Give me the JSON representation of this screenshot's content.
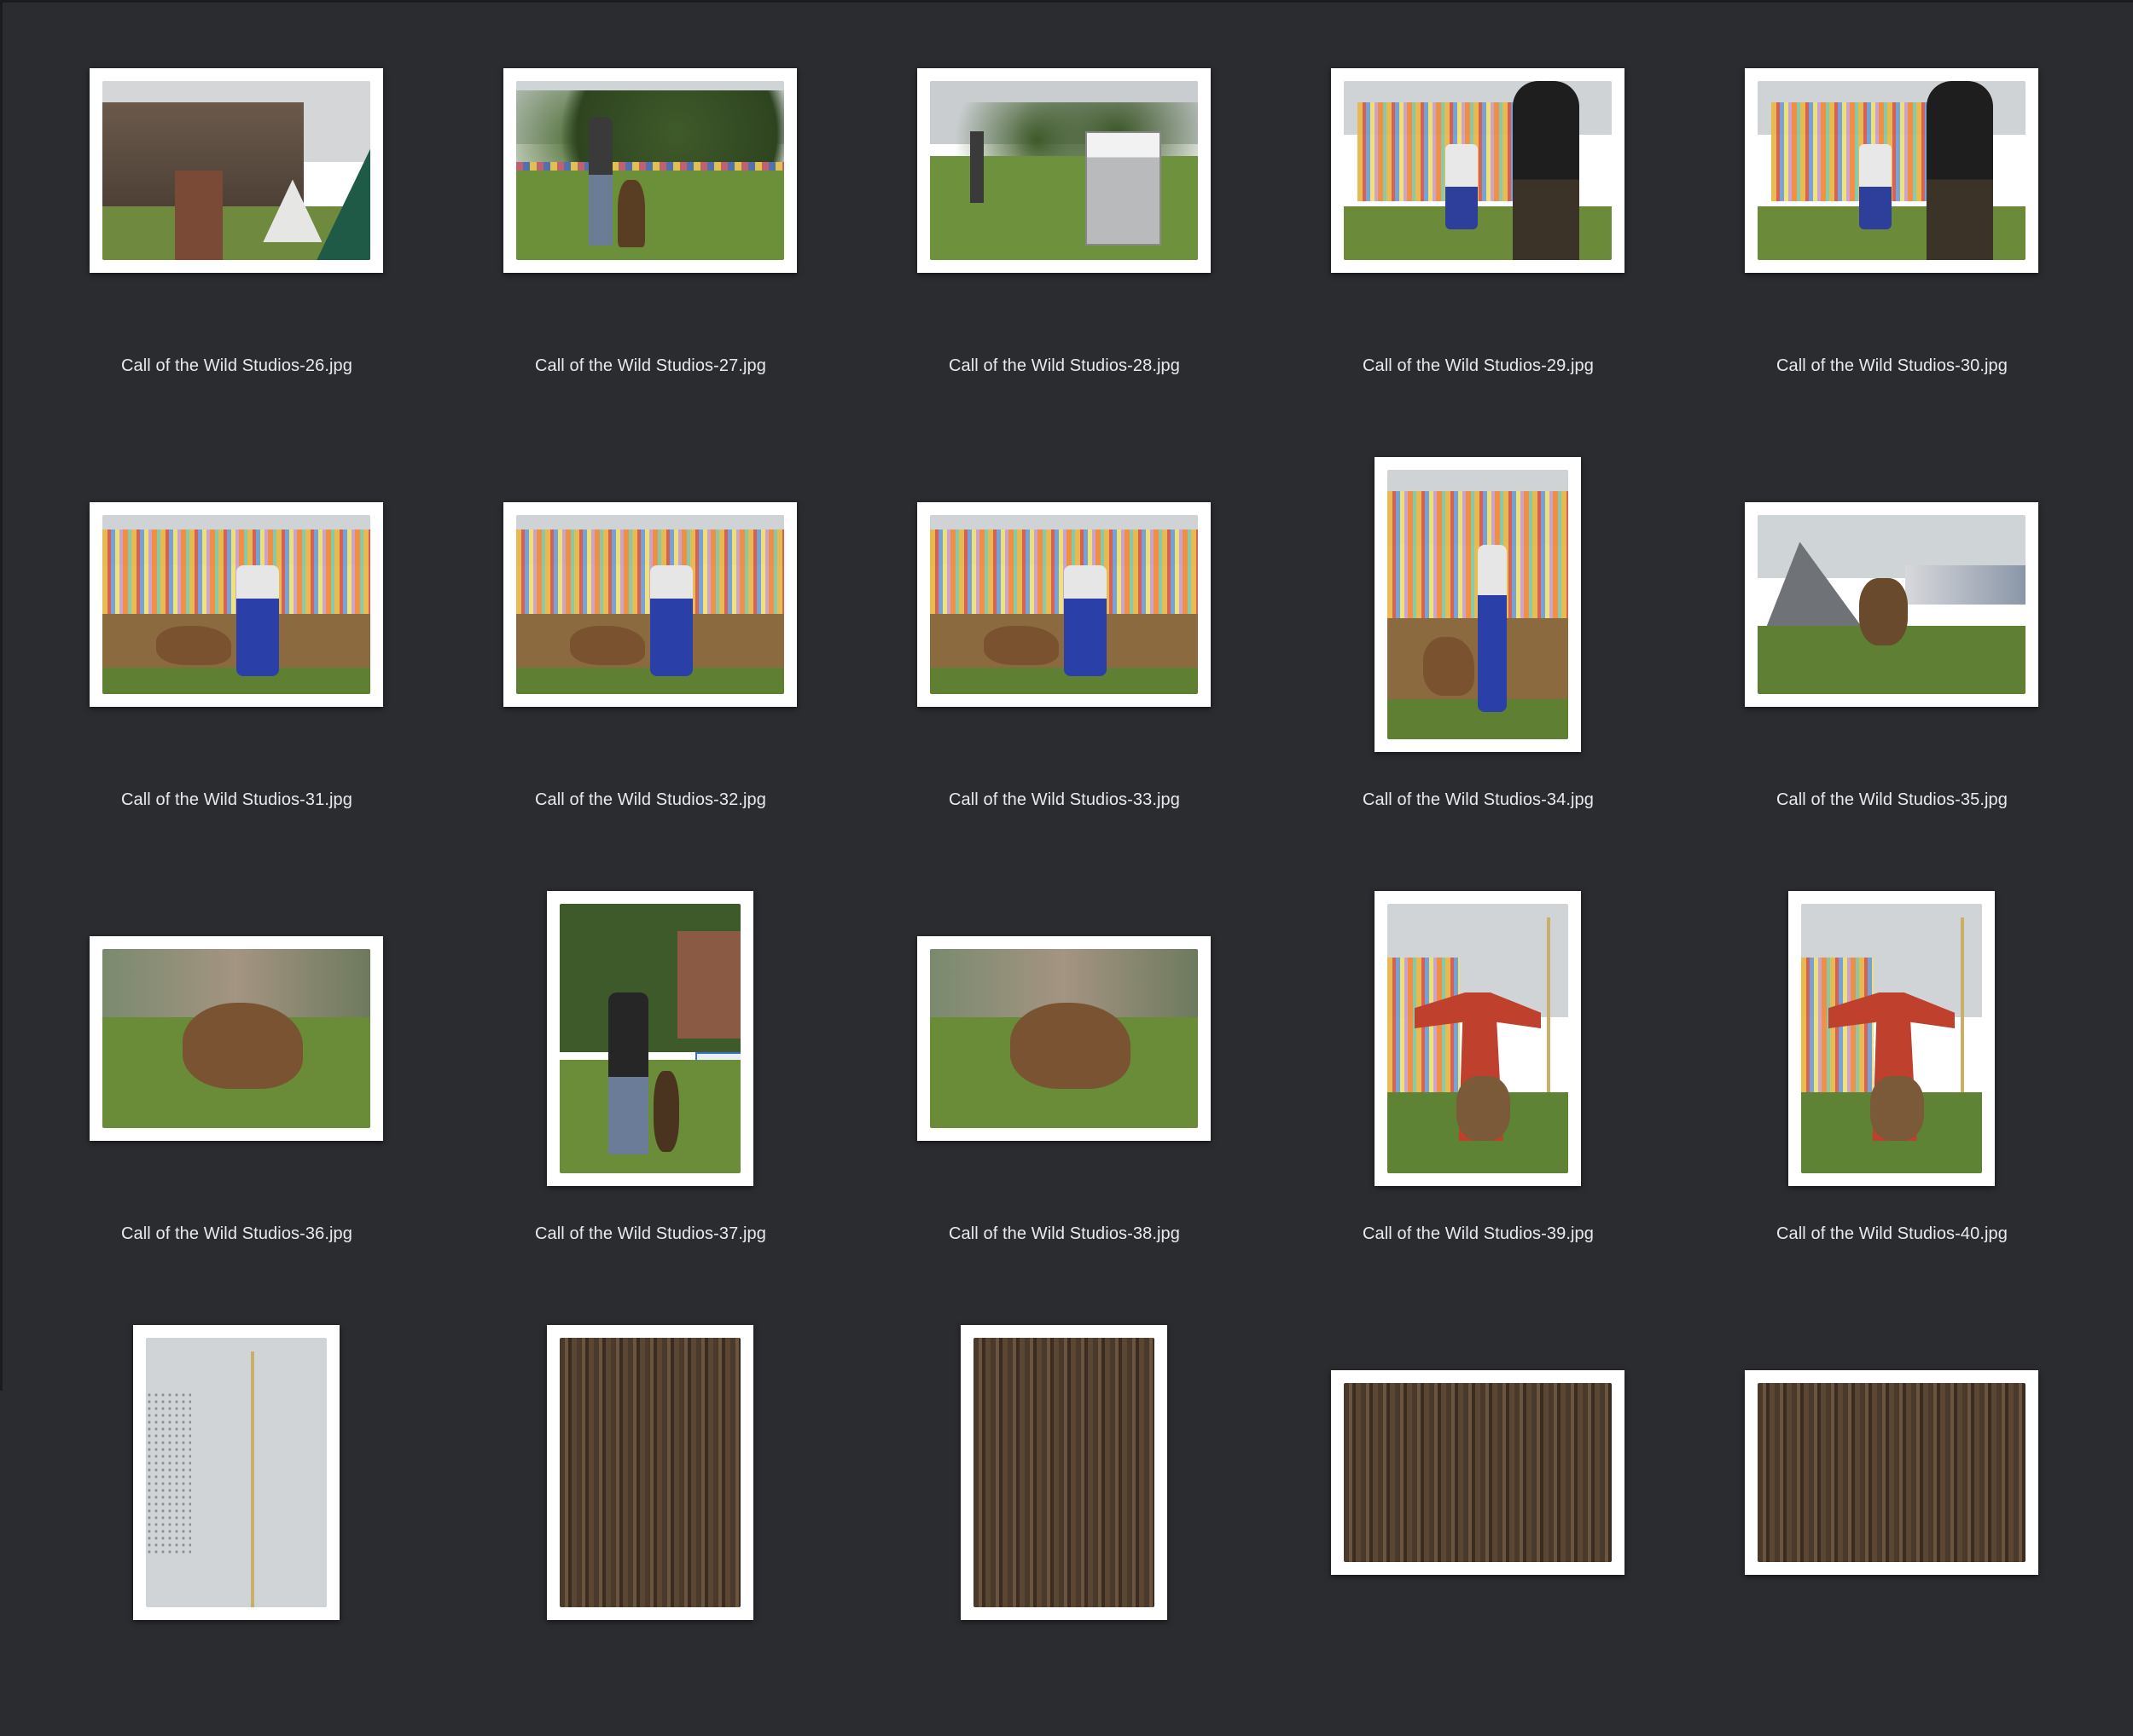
{
  "thumbnails": [
    {
      "filename": "Call of the Wild Studios-26.jpg",
      "orientation": "landscape",
      "scene": "barn"
    },
    {
      "filename": "Call of the Wild Studios-27.jpg",
      "orientation": "landscape",
      "scene": "handler-field"
    },
    {
      "filename": "Call of the Wild Studios-28.jpg",
      "orientation": "landscape",
      "scene": "field-sign"
    },
    {
      "filename": "Call of the Wild Studios-29.jpg",
      "orientation": "landscape",
      "scene": "ribbons-person"
    },
    {
      "filename": "Call of the Wild Studios-30.jpg",
      "orientation": "landscape",
      "scene": "ribbons-person"
    },
    {
      "filename": "Call of the Wild Studios-31.jpg",
      "orientation": "landscape",
      "scene": "ribbons-bite"
    },
    {
      "filename": "Call of the Wild Studios-32.jpg",
      "orientation": "landscape",
      "scene": "ribbons-bite"
    },
    {
      "filename": "Call of the Wild Studios-33.jpg",
      "orientation": "landscape",
      "scene": "ribbons-bite"
    },
    {
      "filename": "Call of the Wild Studios-34.jpg",
      "orientation": "portrait",
      "scene": "ribbons-bite"
    },
    {
      "filename": "Call of the Wild Studios-35.jpg",
      "orientation": "landscape",
      "scene": "tent-dog"
    },
    {
      "filename": "Call of the Wild Studios-36.jpg",
      "orientation": "landscape",
      "scene": "dog-running"
    },
    {
      "filename": "Call of the Wild Studios-37.jpg",
      "orientation": "portrait",
      "scene": "handler-trees"
    },
    {
      "filename": "Call of the Wild Studios-38.jpg",
      "orientation": "landscape",
      "scene": "dog-running"
    },
    {
      "filename": "Call of the Wild Studios-39.jpg",
      "orientation": "portrait",
      "scene": "red-suit"
    },
    {
      "filename": "Call of the Wild Studios-40.jpg",
      "orientation": "portrait",
      "scene": "red-suit"
    },
    {
      "filename": "",
      "orientation": "portrait",
      "scene": "pole"
    },
    {
      "filename": "",
      "orientation": "portrait",
      "scene": "wood"
    },
    {
      "filename": "",
      "orientation": "portrait",
      "scene": "wood"
    },
    {
      "filename": "",
      "orientation": "landscape",
      "scene": "wood"
    },
    {
      "filename": "",
      "orientation": "landscape",
      "scene": "wood"
    }
  ],
  "colors": {
    "background": "#2a2c30",
    "frame": "#ffffff",
    "caption": "#e9eaec"
  }
}
